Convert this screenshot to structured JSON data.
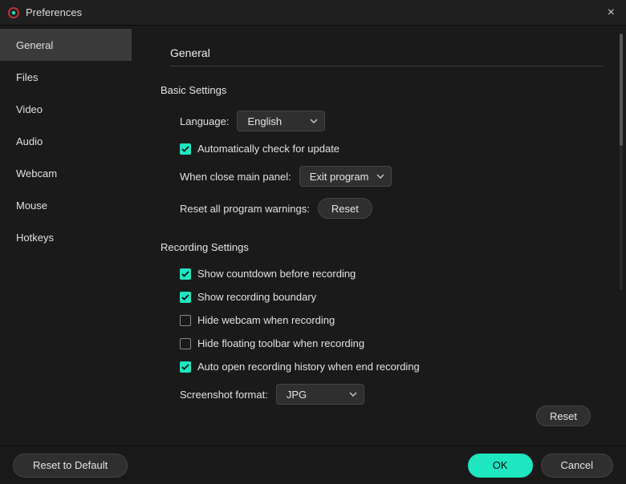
{
  "window": {
    "title": "Preferences",
    "close": "×"
  },
  "sidebar": {
    "items": [
      {
        "label": "General",
        "active": true
      },
      {
        "label": "Files"
      },
      {
        "label": "Video"
      },
      {
        "label": "Audio"
      },
      {
        "label": "Webcam"
      },
      {
        "label": "Mouse"
      },
      {
        "label": "Hotkeys"
      }
    ]
  },
  "section": {
    "title": "General",
    "basic": {
      "heading": "Basic Settings",
      "language_label": "Language:",
      "language_value": "English",
      "auto_update_label": "Automatically check for update",
      "auto_update_checked": true,
      "close_panel_label": "When close main panel:",
      "close_panel_value": "Exit program",
      "reset_warnings_label": "Reset all program warnings:",
      "reset_btn": "Reset"
    },
    "recording": {
      "heading": "Recording Settings",
      "countdown_label": "Show countdown before recording",
      "countdown_checked": true,
      "boundary_label": "Show recording boundary",
      "boundary_checked": true,
      "hide_webcam_label": "Hide webcam when recording",
      "hide_webcam_checked": false,
      "hide_toolbar_label": "Hide floating toolbar when recording",
      "hide_toolbar_checked": false,
      "auto_open_label": "Auto open recording history when end recording",
      "auto_open_checked": true,
      "screenshot_format_label": "Screenshot format:",
      "screenshot_format_value": "JPG"
    },
    "reset_section": "Reset"
  },
  "footer": {
    "reset_default": "Reset to Default",
    "ok": "OK",
    "cancel": "Cancel"
  }
}
